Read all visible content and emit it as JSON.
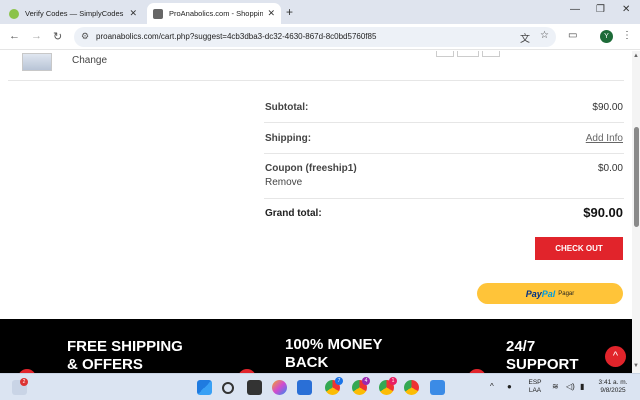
{
  "browser": {
    "tabs": [
      {
        "title": "Verify Codes — SimplyCodes",
        "active": false
      },
      {
        "title": "ProAnabolics.com - Shopping C",
        "active": true
      }
    ],
    "new_tab": "+",
    "url": "proanabolics.com/cart.php?suggest=4cb3dba3-dc32-4630-867d-8c0bd5760f85",
    "profile_initial": "Y"
  },
  "cart": {
    "change_link": "Change",
    "subtotal_label": "Subtotal:",
    "subtotal_value": "$90.00",
    "shipping_label": "Shipping:",
    "shipping_value": "Add Info",
    "coupon_label": "Coupon (freeship1)",
    "coupon_value": "$0.00",
    "remove_label": "Remove",
    "grand_total_label": "Grand total:",
    "grand_total_value": "$90.00",
    "checkout_label": "CHECK OUT",
    "paypal_pay": "Pay",
    "paypal_pal": "Pal",
    "paypal_pagar": "Pagar"
  },
  "footer": {
    "features": [
      "FREE SHIPPING\n& OFFERS",
      "100% MONEY\nBACK",
      "24/7\nSUPPORT"
    ]
  },
  "taskbar": {
    "notification_count": "2",
    "chrome_badges": [
      "7",
      "4",
      "1"
    ],
    "language": "ESP",
    "language_region": "LAA",
    "time": "3:41 a. m.",
    "date": "9/8/2025"
  },
  "colors": {
    "accent_red": "#e1242b",
    "paypal_yellow": "#ffc439",
    "footer_black": "#000000"
  }
}
